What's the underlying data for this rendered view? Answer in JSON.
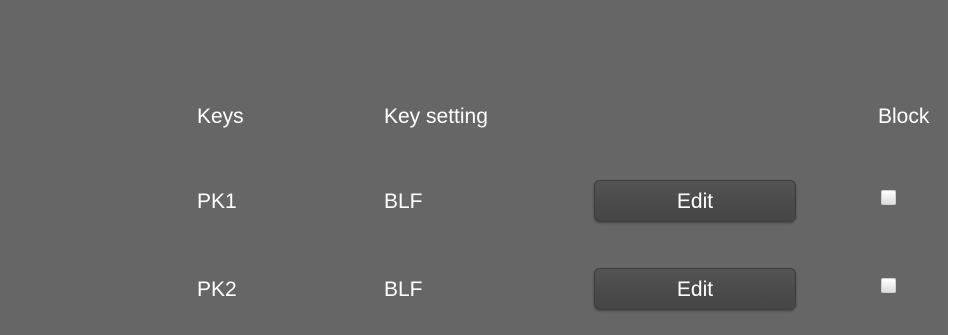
{
  "table": {
    "headers": {
      "keys": "Keys",
      "key_setting": "Key setting",
      "block": "Block"
    },
    "rows": [
      {
        "key": "PK1",
        "setting": "BLF",
        "edit_label": "Edit",
        "block_checked": false
      },
      {
        "key": "PK2",
        "setting": "BLF",
        "edit_label": "Edit",
        "block_checked": false
      }
    ]
  },
  "colors": {
    "panel_background": "#666666",
    "text": "#ffffff",
    "button_background": "#4a4a4a",
    "checkbox_fill": "#f0f0f0"
  }
}
